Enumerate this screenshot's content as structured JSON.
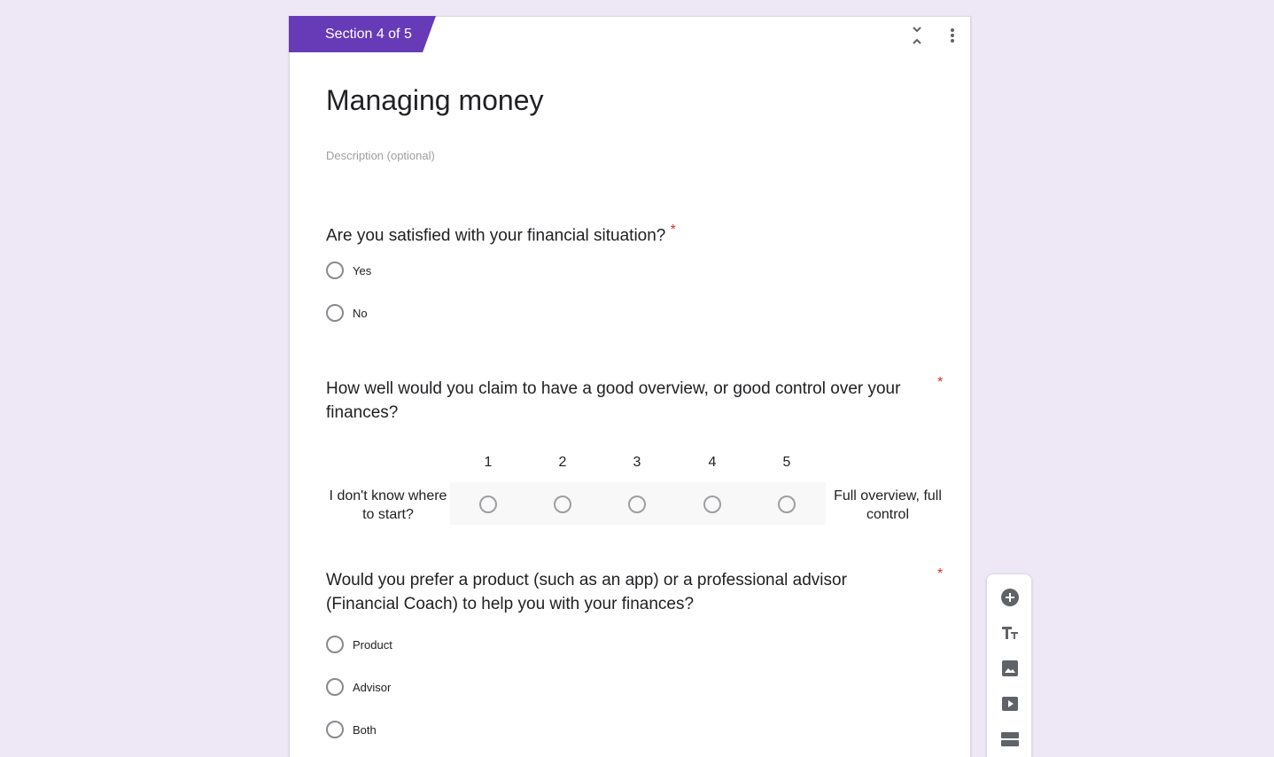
{
  "section": {
    "badge": "Section 4 of 5",
    "title": "Managing money",
    "description_placeholder": "Description (optional)"
  },
  "questions": [
    {
      "text": "Are you satisfied with your financial situation?",
      "required_mark": "*",
      "options": [
        "Yes",
        "No"
      ]
    },
    {
      "text": "How well would you claim to have a good overview, or good control over your finances?",
      "required_mark": "*",
      "scale": {
        "values": [
          "1",
          "2",
          "3",
          "4",
          "5"
        ],
        "low_label": "I don't know where to start?",
        "high_label": "Full overview, full control"
      }
    },
    {
      "text": "Would you prefer a product (such as an app) or a professional advisor (Financial Coach) to help you with your finances?",
      "required_mark": "*",
      "options": [
        "Product",
        "Advisor",
        "Both"
      ]
    }
  ],
  "icons": {
    "collapse": "collapse-icon",
    "more": "more-vert-icon",
    "toolbar": [
      "add-question-icon",
      "add-title-icon",
      "add-image-icon",
      "add-video-icon",
      "add-section-icon"
    ]
  },
  "colors": {
    "accent": "#673ab7",
    "background": "#ede7f6",
    "required": "#d93025",
    "icon": "#5f6368"
  }
}
